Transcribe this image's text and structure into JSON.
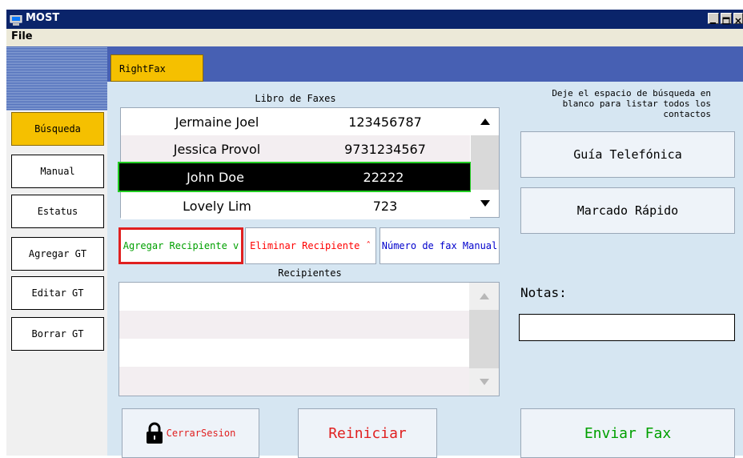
{
  "window": {
    "title": "MOST",
    "menu": [
      "File"
    ]
  },
  "sidebar": {
    "items": [
      {
        "label": "Búsqueda",
        "active": true
      },
      {
        "label": "Manual"
      },
      {
        "label": "Estatus"
      },
      {
        "label": "Agregar GT"
      },
      {
        "label": "Editar GT"
      },
      {
        "label": "Borrar GT"
      }
    ]
  },
  "tab": {
    "label": "RightFax"
  },
  "fax_book": {
    "title": "Libro de Faxes",
    "rows": [
      {
        "name": "Jermaine Joel",
        "number": "123456787"
      },
      {
        "name": "Jessica Provol",
        "number": "9731234567"
      },
      {
        "name": "John Doe",
        "number": "22222",
        "selected": true
      },
      {
        "name": "Lovely Lim",
        "number": "723"
      }
    ]
  },
  "actions": {
    "add": "Agregar Recipiente v",
    "remove": "Eliminar Recipiente ˆ",
    "manual_fax": "Número de fax Manual"
  },
  "recipients": {
    "title": "Recipientes",
    "rows": []
  },
  "right": {
    "hint": "Deje el espacio de búsqueda en blanco para listar todos los contactos",
    "phone_guide": "Guía Telefónica",
    "speed_dial": "Marcado Rápido",
    "notes_label": "Notas:",
    "notes_value": ""
  },
  "bottom": {
    "logout": "CerrarSesion",
    "reset": "Reiniciar",
    "send": "Enviar Fax"
  },
  "colors": {
    "titlebar": "#0a246a",
    "accent_tab": "#f5c000",
    "blue_bar": "#4760b3",
    "main_bg": "#d6e6f2",
    "add_text": "#00a000",
    "remove_text": "#ff0000",
    "manual_text": "#0000cc",
    "highlight_add": "#e02020",
    "selected_row_border": "#22cc22"
  }
}
